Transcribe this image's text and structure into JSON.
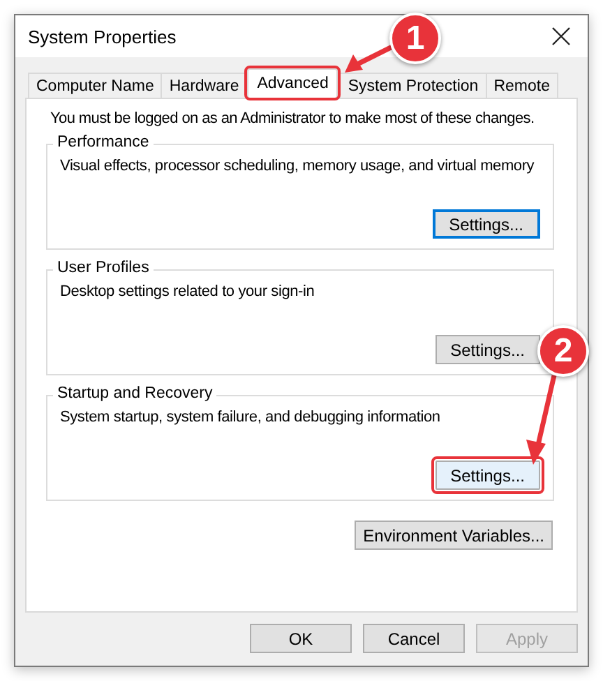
{
  "window": {
    "title": "System Properties"
  },
  "tabs": [
    {
      "label": "Computer Name",
      "selected": false,
      "highlighted": false
    },
    {
      "label": "Hardware",
      "selected": false,
      "highlighted": false
    },
    {
      "label": "Advanced",
      "selected": true,
      "highlighted": true
    },
    {
      "label": "System Protection",
      "selected": false,
      "highlighted": false
    },
    {
      "label": "Remote",
      "selected": false,
      "highlighted": false
    }
  ],
  "notice": "You must be logged on as an Administrator to make most of these changes.",
  "groups": [
    {
      "title": "Performance",
      "description": "Visual effects, processor scheduling, memory usage, and virtual memory",
      "button": {
        "label": "Settings...",
        "focused": true,
        "highlighted": false
      }
    },
    {
      "title": "User Profiles",
      "description": "Desktop settings related to your sign-in",
      "button": {
        "label": "Settings...",
        "focused": false,
        "highlighted": false
      }
    },
    {
      "title": "Startup and Recovery",
      "description": "System startup, system failure, and debugging information",
      "button": {
        "label": "Settings...",
        "focused": false,
        "highlighted": true
      }
    }
  ],
  "environment_button": "Environment Variables...",
  "buttons": [
    {
      "label": "OK",
      "disabled": false
    },
    {
      "label": "Cancel",
      "disabled": false
    },
    {
      "label": "Apply",
      "disabled": true
    }
  ],
  "annotations": [
    {
      "number": "1"
    },
    {
      "number": "2"
    }
  ]
}
